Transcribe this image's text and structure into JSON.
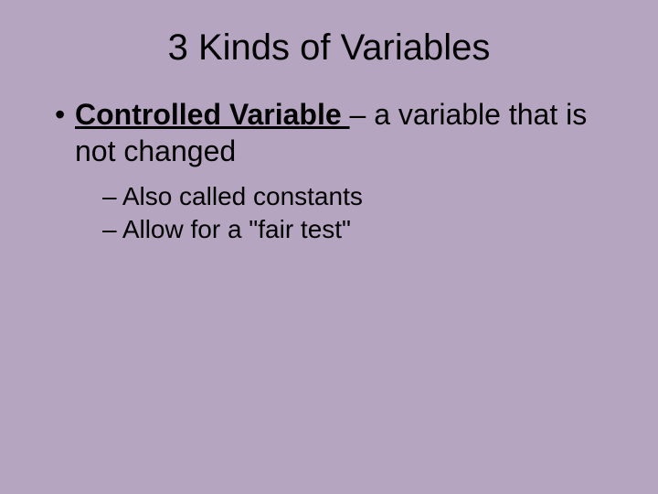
{
  "title": "3 Kinds of Variables",
  "bullet1": {
    "mark": "•",
    "term": "Controlled Variable ",
    "definition": "– a variable that is not changed"
  },
  "sub": {
    "dash": "–",
    "item1": " Also called constants",
    "item2": " Allow for a \"fair test\""
  }
}
